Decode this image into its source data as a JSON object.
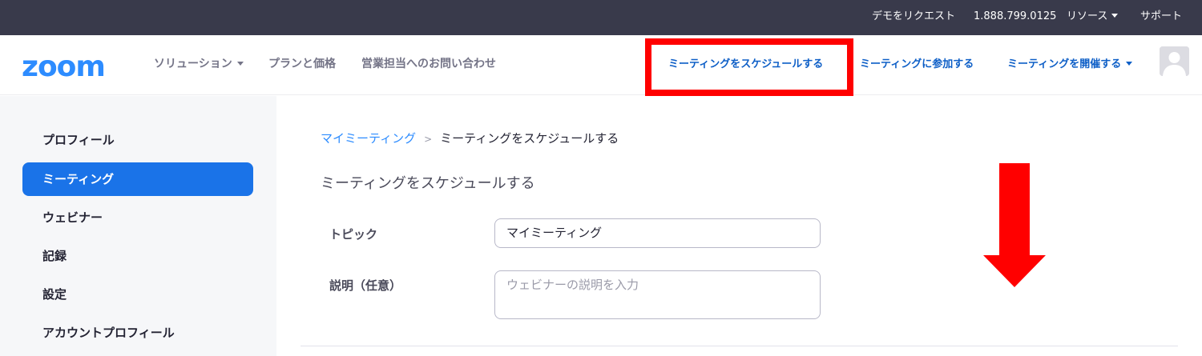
{
  "topbar": {
    "demo_request": "デモをリクエスト",
    "phone": "1.888.799.0125",
    "resources": "リソース",
    "support": "サポート"
  },
  "nav": {
    "logo": "zoom",
    "solutions": "ソリューション",
    "plans_pricing": "プランと価格",
    "contact_sales": "営業担当へのお問い合わせ",
    "schedule_meeting": "ミーティングをスケジュールする",
    "join_meeting": "ミーティングに参加する",
    "host_meeting": "ミーティングを開催する"
  },
  "sidebar": {
    "items": [
      {
        "label": "プロフィール",
        "active": false
      },
      {
        "label": "ミーティング",
        "active": true
      },
      {
        "label": "ウェビナー",
        "active": false
      },
      {
        "label": "記録",
        "active": false
      },
      {
        "label": "設定",
        "active": false
      },
      {
        "label": "アカウントプロフィール",
        "active": false
      }
    ]
  },
  "main": {
    "breadcrumb": {
      "parent": "マイミーティング",
      "separator": ">",
      "current": "ミーティングをスケジュールする"
    },
    "title": "ミーティングをスケジュールする",
    "topic": {
      "label": "トピック",
      "value": "マイミーティング"
    },
    "description": {
      "label": "説明（任意）",
      "placeholder": "ウェビナーの説明を入力"
    }
  },
  "colors": {
    "topbar_bg": "#393a4b",
    "brand_blue": "#2d8cff",
    "link_blue": "#0e5fc7",
    "active_blue": "#1a73e8",
    "highlight_red": "#ff0000"
  }
}
